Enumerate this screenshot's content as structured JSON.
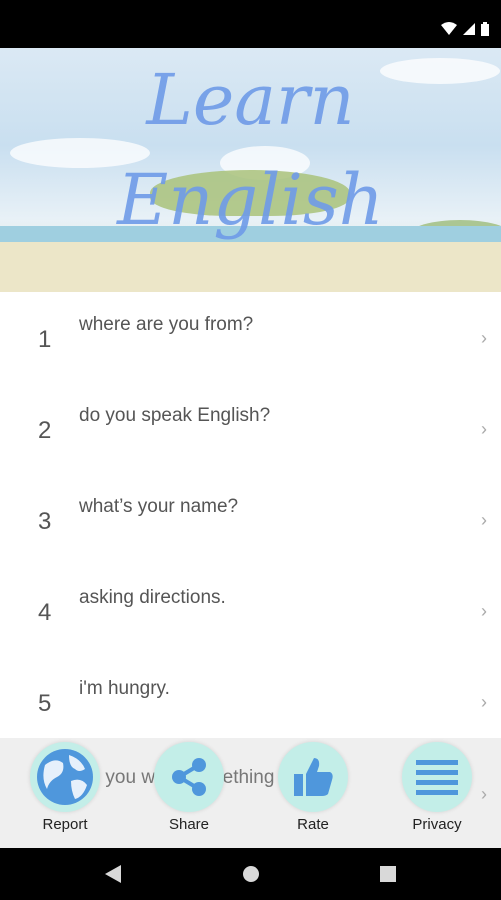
{
  "hero": {
    "title_line1": "Learn",
    "title_line2": "English"
  },
  "list": [
    {
      "number": "1",
      "label": "where are you from?"
    },
    {
      "number": "2",
      "label": "do you speak English?"
    },
    {
      "number": "3",
      "label": "what’s your name?"
    },
    {
      "number": "4",
      "label": "asking directions."
    },
    {
      "number": "5",
      "label": "i'm hungry."
    }
  ],
  "partial_item": {
    "label": "do you want something to drink"
  },
  "actions": [
    {
      "label": "Report",
      "icon": "globe-icon"
    },
    {
      "label": "Share",
      "icon": "share-icon"
    },
    {
      "label": "Rate",
      "icon": "thumbs-up-icon"
    },
    {
      "label": "Privacy",
      "icon": "menu-icon"
    }
  ],
  "chevron": "›"
}
